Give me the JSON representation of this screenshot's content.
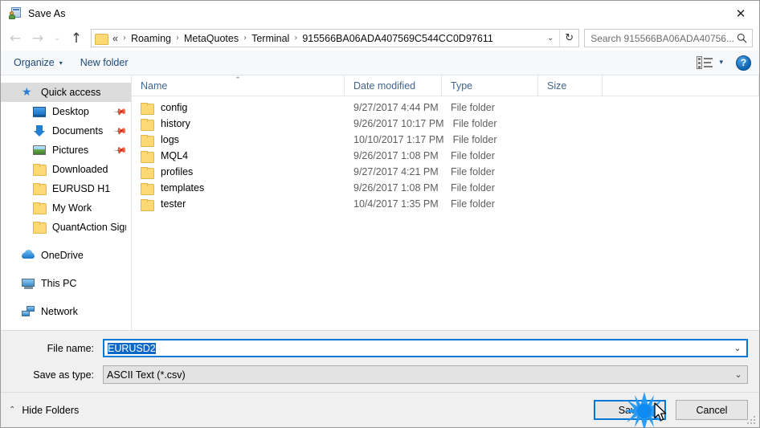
{
  "window": {
    "title": "Save As",
    "icon": "save-as-app-icon",
    "close_label": "✕"
  },
  "navigation": {
    "back_icon": "←",
    "forward_icon": "→",
    "recent_icon": "⌄",
    "up_icon": "↑",
    "breadcrumb_lead": "«",
    "breadcrumb": [
      "Roaming",
      "MetaQuotes",
      "Terminal",
      "915566BA06ADA407569C544CC0D97611"
    ],
    "separator": "›",
    "dropdown_icon": "⌄",
    "refresh_icon": "↻"
  },
  "search": {
    "placeholder": "Search 915566BA06ADA40756...",
    "icon": "search-icon"
  },
  "toolbar": {
    "organize_label": "Organize",
    "organize_caret": "▾",
    "new_folder_label": "New folder",
    "view_caret": "▾",
    "help_label": "?"
  },
  "sidebar": {
    "groups": [
      {
        "header": {
          "label": "Quick access",
          "icon": "star-icon",
          "selected": true
        },
        "items": [
          {
            "label": "Desktop",
            "icon": "desktop-icon",
            "pinned": true
          },
          {
            "label": "Documents",
            "icon": "documents-icon",
            "pinned": true
          },
          {
            "label": "Pictures",
            "icon": "pictures-icon",
            "pinned": true
          },
          {
            "label": "Downloaded",
            "icon": "folder-icon",
            "pinned": false
          },
          {
            "label": "EURUSD H1",
            "icon": "folder-icon",
            "pinned": false
          },
          {
            "label": "My Work",
            "icon": "folder-icon",
            "pinned": false
          },
          {
            "label": "QuantAction Signal",
            "icon": "folder-icon",
            "pinned": false
          }
        ]
      },
      {
        "header": {
          "label": "OneDrive",
          "icon": "onedrive-icon",
          "selected": false
        },
        "items": []
      },
      {
        "header": {
          "label": "This PC",
          "icon": "this-pc-icon",
          "selected": false
        },
        "items": []
      },
      {
        "header": {
          "label": "Network",
          "icon": "network-icon",
          "selected": false
        },
        "items": []
      }
    ]
  },
  "file_list": {
    "columns": [
      {
        "key": "name",
        "label": "Name",
        "sorted": true,
        "sort_caret": "⌃"
      },
      {
        "key": "date",
        "label": "Date modified"
      },
      {
        "key": "type",
        "label": "Type"
      },
      {
        "key": "size",
        "label": "Size"
      }
    ],
    "rows": [
      {
        "name": "config",
        "date": "9/27/2017 4:44 PM",
        "type": "File folder",
        "size": "",
        "icon": "folder-icon"
      },
      {
        "name": "history",
        "date": "9/26/2017 10:17 PM",
        "type": "File folder",
        "size": "",
        "icon": "folder-icon"
      },
      {
        "name": "logs",
        "date": "10/10/2017 1:17 PM",
        "type": "File folder",
        "size": "",
        "icon": "folder-icon"
      },
      {
        "name": "MQL4",
        "date": "9/26/2017 1:08 PM",
        "type": "File folder",
        "size": "",
        "icon": "folder-icon"
      },
      {
        "name": "profiles",
        "date": "9/27/2017 4:21 PM",
        "type": "File folder",
        "size": "",
        "icon": "folder-icon"
      },
      {
        "name": "templates",
        "date": "9/26/2017 1:08 PM",
        "type": "File folder",
        "size": "",
        "icon": "folder-icon"
      },
      {
        "name": "tester",
        "date": "10/4/2017 1:35 PM",
        "type": "File folder",
        "size": "",
        "icon": "folder-icon"
      }
    ]
  },
  "form": {
    "file_name_label": "File name:",
    "file_name_value": "EURUSD2",
    "file_name_selected": true,
    "save_as_type_label": "Save as type:",
    "save_as_type_value": "ASCII Text (*.csv)",
    "chevron": "⌄"
  },
  "footer": {
    "hide_folders_label": "Hide Folders",
    "hide_folders_caret": "⌃",
    "save_label": "Save",
    "cancel_label": "Cancel"
  },
  "colors": {
    "accent": "#0078d7",
    "link": "#1b4a7a",
    "column_header": "#41658f",
    "folder": "#fcd975",
    "selection": "#0a68c8",
    "sidebar_selected": "#dcdcdc"
  }
}
